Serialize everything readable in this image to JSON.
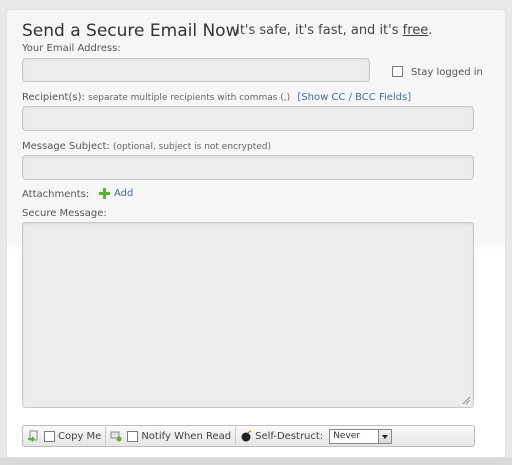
{
  "header": {
    "title": "Send a Secure Email Now",
    "tagline_prefix": "It's safe, it's fast, and it's ",
    "tagline_link": "free",
    "tagline_suffix": "."
  },
  "form": {
    "email_label": "Your Email Address:",
    "stay_logged_in": "Stay logged in",
    "recipients_label": "Recipient(s):",
    "recipients_hint": "separate multiple recipients with commas (,)",
    "show_cc_bcc": "[Show CC / BCC Fields]",
    "subject_label": "Message Subject:",
    "subject_hint": "(optional, subject is not encrypted)",
    "attachments_label": "Attachments:",
    "add_label": "Add",
    "message_label": "Secure Message:"
  },
  "toolbar": {
    "copy_me": "Copy Me",
    "notify_when_read": "Notify When Read",
    "self_destruct_label": "Self-Destruct:",
    "self_destruct_value": "Never"
  },
  "icons": {
    "copy": "copy-icon",
    "notify": "notify-icon",
    "bomb": "bomb-icon",
    "add": "plus-icon"
  }
}
